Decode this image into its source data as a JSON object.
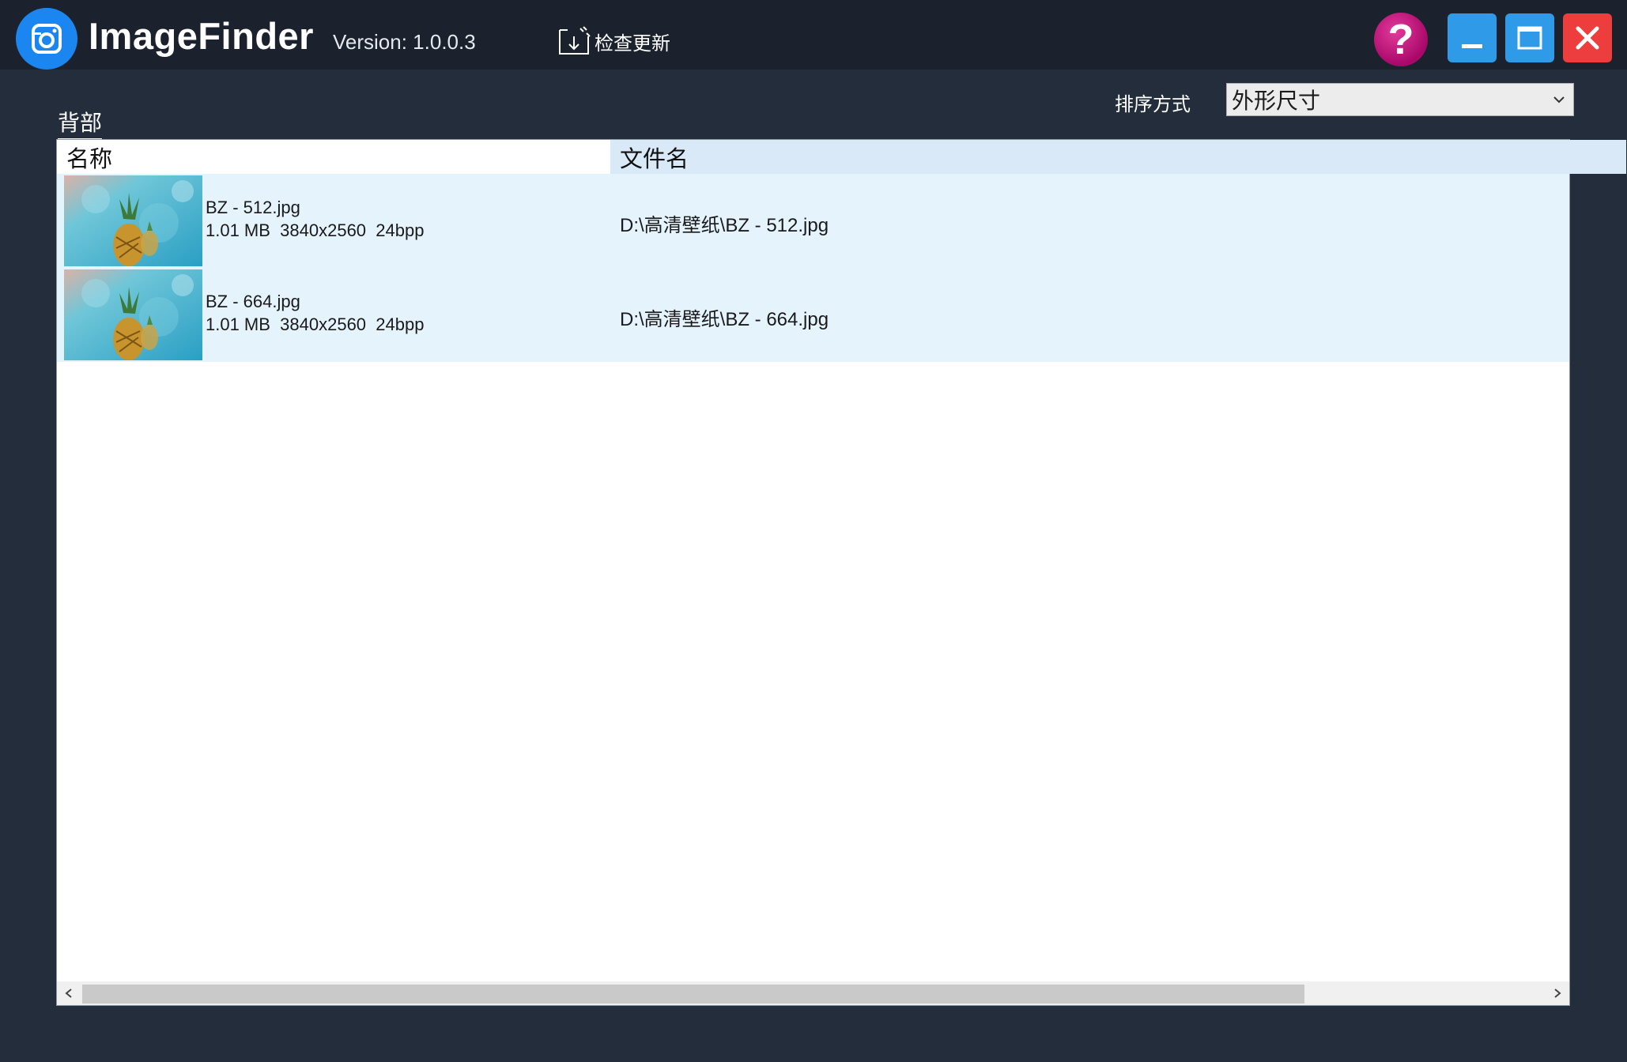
{
  "app": {
    "title": "ImageFinder",
    "version": "Version: 1.0.0.3",
    "update_label": "检查更新",
    "help_label": "?",
    "logo_icon": "camera-icon"
  },
  "toolbar": {
    "sort_label": "排序方式",
    "sort_value": "外形尺寸",
    "group_label": "背部"
  },
  "list": {
    "columns": [
      "名称",
      "文件名"
    ],
    "items": [
      {
        "filename": "BZ - 512.jpg",
        "size": "1.01 MB",
        "dimensions": "3840x2560",
        "depth": "24bpp",
        "meta": "1.01 MB  3840x2560  24bpp",
        "path": "D:\\高清壁纸\\BZ - 512.jpg"
      },
      {
        "filename": "BZ - 664.jpg",
        "size": "1.01 MB",
        "dimensions": "3840x2560",
        "depth": "24bpp",
        "meta": "1.01 MB  3840x2560  24bpp",
        "path": "D:\\高清壁纸\\BZ - 664.jpg"
      }
    ]
  },
  "colors": {
    "window_bg": "#232d3b",
    "titlebar_bg": "#1b222d",
    "accent_blue": "#2e9ae8",
    "close_red": "#ee3d3d",
    "help_magenta": "#c0157d",
    "row_selected_bg": "#e5f3fd",
    "header_bg": "#d9e9f8"
  }
}
